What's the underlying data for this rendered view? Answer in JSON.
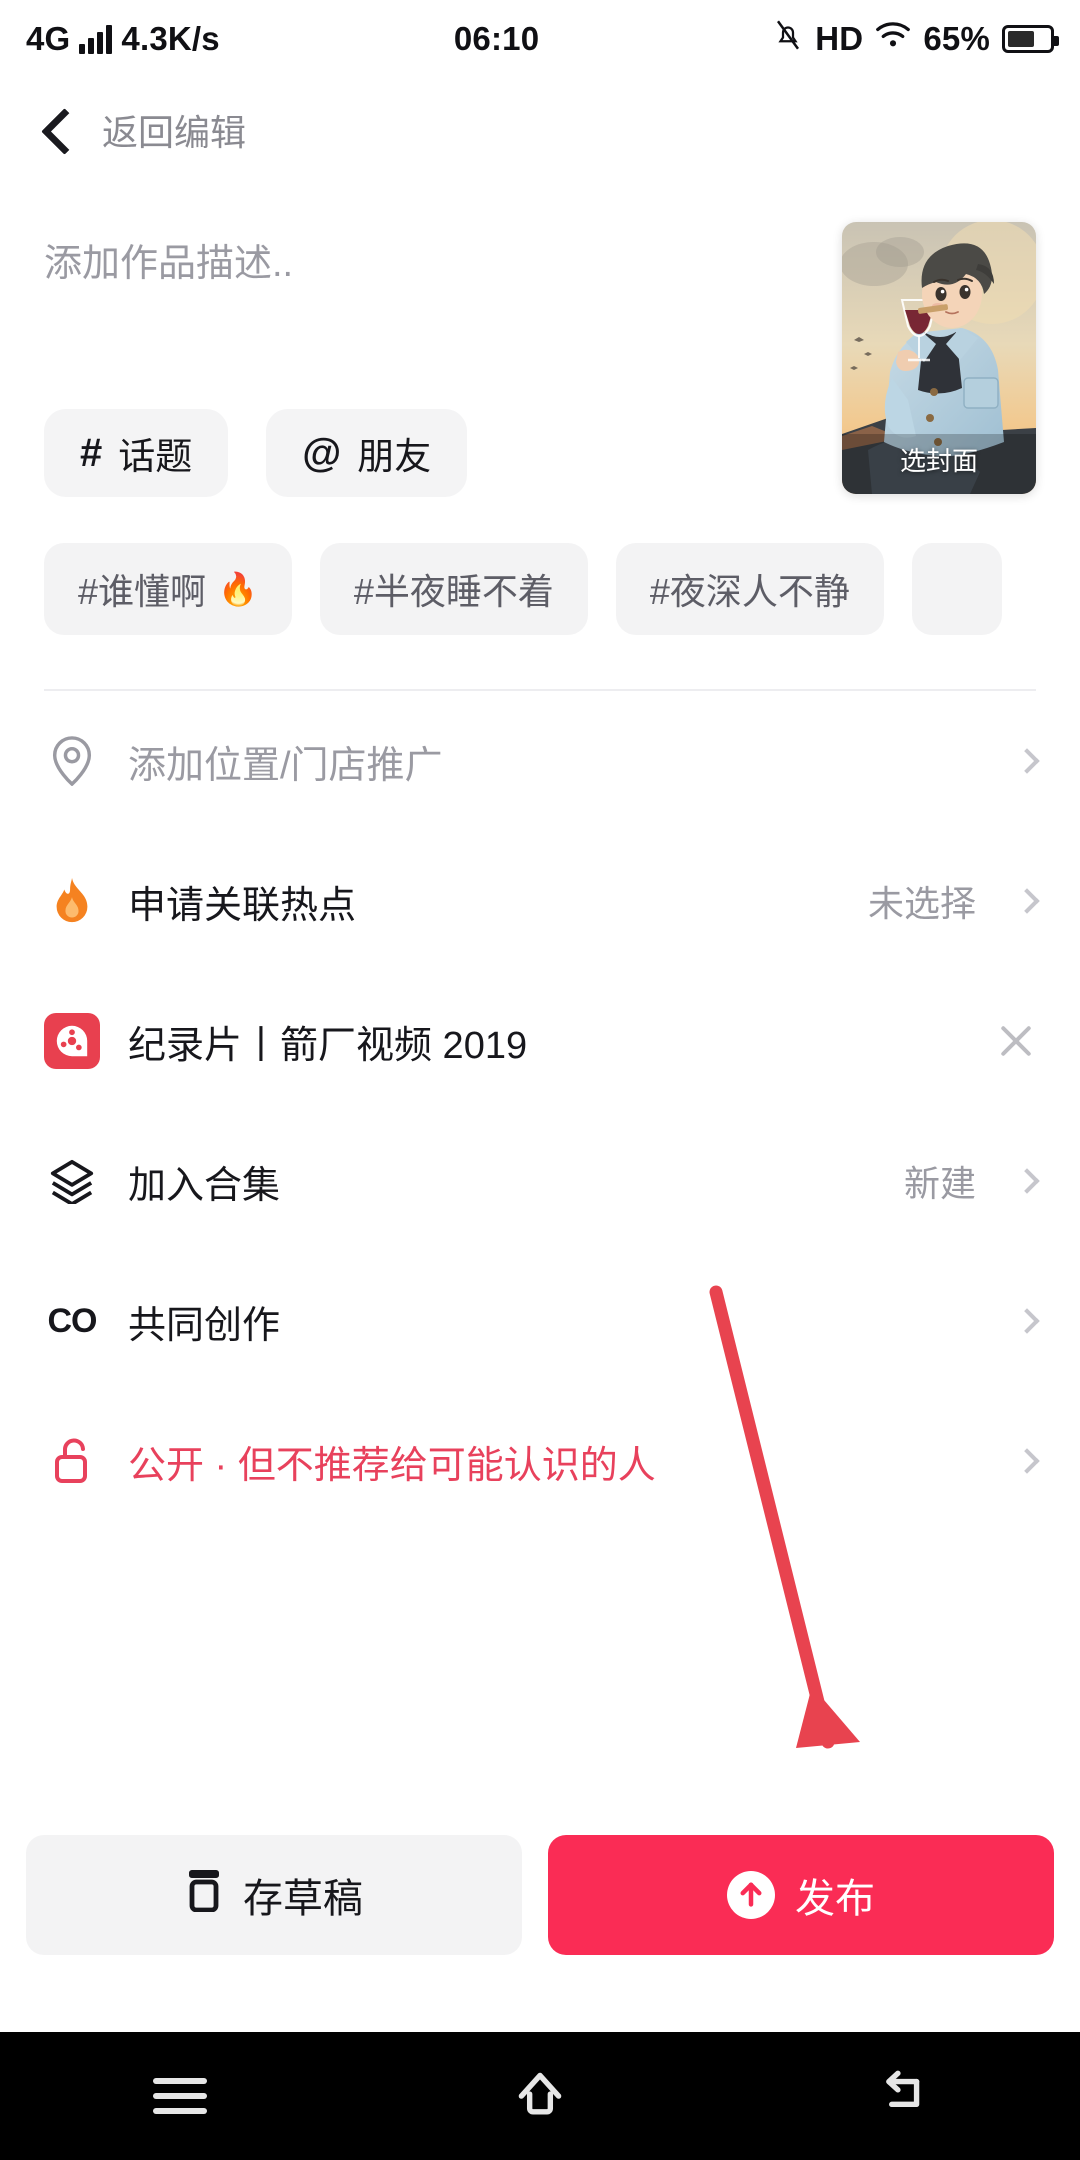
{
  "status_bar": {
    "network_type": "4G",
    "speed": "4.3K/s",
    "time": "06:10",
    "hd_label": "HD",
    "battery_percent": "65%",
    "signal_icon": "signal-bars-icon",
    "mute_icon": "bell-muted-icon",
    "wifi_icon": "wifi-icon",
    "battery_icon": "battery-icon"
  },
  "header": {
    "back_icon": "back-chevron-icon",
    "title": "返回编辑"
  },
  "composer": {
    "description_placeholder": "添加作品描述..",
    "description_value": "",
    "chips": [
      {
        "symbol": "#",
        "label": "话题",
        "name": "topic"
      },
      {
        "symbol": "@",
        "label": "朋友",
        "name": "friend"
      }
    ],
    "cover": {
      "label": "选封面",
      "alt": "anime-boy-with-wine-glass-cover"
    }
  },
  "suggested_tags": [
    {
      "text": "#谁懂啊",
      "emoji": "🔥"
    },
    {
      "text": "#半夜睡不着",
      "emoji": ""
    },
    {
      "text": "#夜深人不静",
      "emoji": ""
    },
    {
      "text": "",
      "emoji": ""
    }
  ],
  "rows": [
    {
      "name": "location",
      "icon": "location-pin-icon",
      "label": "添加位置/门店推广",
      "label_style": "muted",
      "value": "",
      "trailing": "chevron"
    },
    {
      "name": "hotspot",
      "icon": "flame-icon",
      "label": "申请关联热点",
      "label_style": "normal",
      "value": "未选择",
      "trailing": "chevron"
    },
    {
      "name": "program",
      "icon": "film-reel-icon",
      "label": "纪录片丨箭厂视频 2019",
      "label_style": "normal",
      "value": "",
      "trailing": "close"
    },
    {
      "name": "collection",
      "icon": "layers-icon",
      "label": "加入合集",
      "label_style": "normal",
      "value": "新建",
      "trailing": "chevron"
    },
    {
      "name": "co-creation",
      "icon": "co-icon",
      "label": "共同创作",
      "label_style": "normal",
      "value": "",
      "trailing": "chevron"
    },
    {
      "name": "privacy",
      "icon": "unlock-icon",
      "label": "公开 · 但不推荐给可能认识的人",
      "label_style": "danger",
      "value": "",
      "trailing": "chevron"
    }
  ],
  "footer": {
    "draft_label": "存草稿",
    "draft_icon": "draft-box-icon",
    "publish_label": "发布",
    "publish_icon": "upload-arrow-icon"
  },
  "navbar": {
    "recents_icon": "recents-icon",
    "home_icon": "home-icon",
    "back_icon": "back-icon"
  },
  "annotation": {
    "arrow_color": "#e8434f",
    "arrow_name": "publish-pointer-arrow"
  },
  "colors": {
    "accent_red": "#fa2c55",
    "danger_text": "#e8415c",
    "chip_bg": "#f3f3f4",
    "muted_text": "#9a9aa2"
  }
}
